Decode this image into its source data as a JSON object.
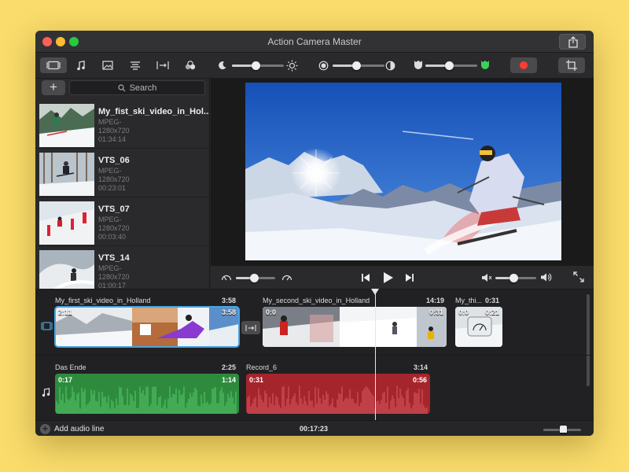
{
  "window": {
    "title": "Action Camera Master"
  },
  "toolbar": {
    "tabs": [
      {
        "name": "video-tab",
        "icon": "film-icon",
        "active": true
      },
      {
        "name": "music-tab",
        "icon": "music-note-icon",
        "active": false
      },
      {
        "name": "photo-tab",
        "icon": "image-icon",
        "active": false
      },
      {
        "name": "titles-tab",
        "icon": "text-lines-icon",
        "active": false
      },
      {
        "name": "transitions-tab",
        "icon": "transition-icon",
        "active": false
      },
      {
        "name": "effects-tab",
        "icon": "effects-icon",
        "active": false
      }
    ],
    "brightness": 0.45,
    "contrast": 0.45,
    "saturation": 0.45
  },
  "sidebar": {
    "add_label": "+",
    "search_placeholder": "Search",
    "items": [
      {
        "name": "My_fist_ski_video_in_Hol...",
        "format": "MPEG-",
        "resolution": "1280x720",
        "duration": "01:34:14"
      },
      {
        "name": "VTS_06",
        "format": "MPEG-",
        "resolution": "1280x720",
        "duration": "00:23:01"
      },
      {
        "name": "VTS_07",
        "format": "MPEG-",
        "resolution": "1280x720",
        "duration": "00:03:40"
      },
      {
        "name": "VTS_14",
        "format": "MPEG-",
        "resolution": "1280x720",
        "duration": "01:00:17"
      }
    ]
  },
  "transport": {
    "speed": 0.45,
    "volume": 0.45
  },
  "timeline": {
    "video_clips": [
      {
        "label": "My_first_ski_video_in_Holland",
        "duration": "3:58",
        "in": "2:11",
        "out": "3:58"
      },
      {
        "label": "My_second_ski_video_in_Holland",
        "duration": "14:19",
        "in": "0:0",
        "out": "0:31"
      },
      {
        "label": "My_thi...",
        "duration": "0:31",
        "in": "0:0",
        "out": "0:21"
      }
    ],
    "audio_clips": [
      {
        "label": "Das Ende",
        "duration": "2:25",
        "in": "0:17",
        "out": "1:14",
        "color": "#2e8b3e"
      },
      {
        "label": "Record_6",
        "duration": "3:14",
        "in": "0:31",
        "out": "0:56",
        "color": "#a5252d"
      }
    ],
    "add_audio_label": "Add audio line",
    "total_time": "00:17:23",
    "zoom": 0.55
  },
  "colors": {
    "accent": "#4aa3df",
    "record": "#ff3b30"
  }
}
